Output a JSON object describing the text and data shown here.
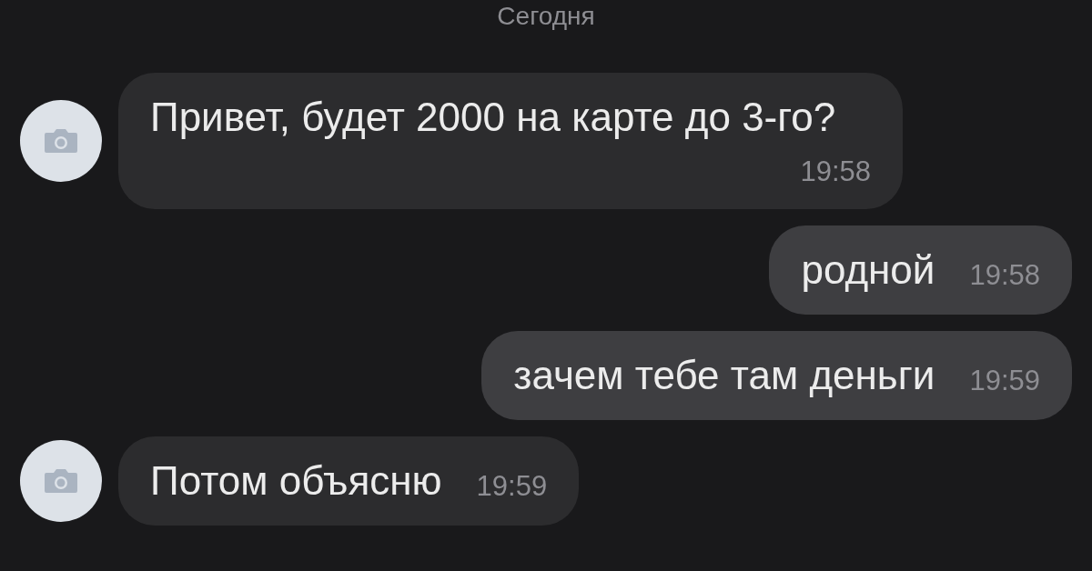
{
  "date_divider": "Сегодня",
  "messages": [
    {
      "kind": "incoming",
      "avatar": true,
      "text": "Привет, будет 2000 на карте до 3-го?",
      "time": "19:58"
    },
    {
      "kind": "outgoing",
      "avatar": false,
      "text": "родной",
      "time": "19:58"
    },
    {
      "kind": "outgoing",
      "avatar": false,
      "text": "зачем тебе там деньги",
      "time": "19:59"
    },
    {
      "kind": "incoming",
      "avatar": true,
      "text": "Потом объясню",
      "time": "19:59"
    }
  ]
}
